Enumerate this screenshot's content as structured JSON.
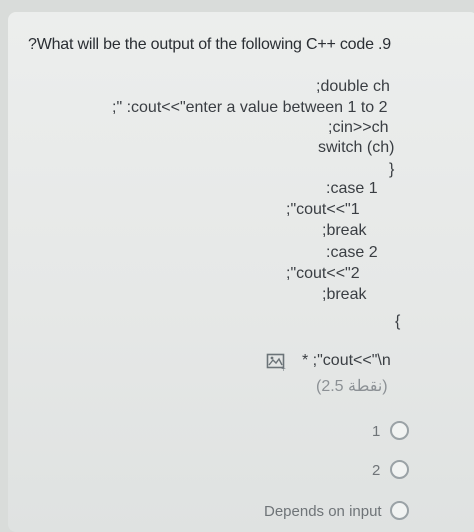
{
  "question": {
    "text": "?What will be the output of the following C++ code .9"
  },
  "code_lines": [
    ";double ch",
    ";\" :cout<<\"enter a value between 1 to 2",
    ";cin>>ch",
    "switch (ch)",
    "}",
    ":case 1",
    ";\"cout<<\"1",
    ";break",
    ":case 2",
    ";\"cout<<\"2",
    ";break",
    "{",
    "* ;\"cout<<\"\\n"
  ],
  "points": "(نقطة 2.5)",
  "icon": "image-icon",
  "options": [
    {
      "label": "1",
      "selected": false
    },
    {
      "label": "2",
      "selected": false
    },
    {
      "label": "Depends on input",
      "selected": false
    }
  ],
  "colors": {
    "background": "#d9dcda",
    "card": "#e8eae9",
    "text": "#2b2f33",
    "radio_border": "#9aa2a6"
  }
}
